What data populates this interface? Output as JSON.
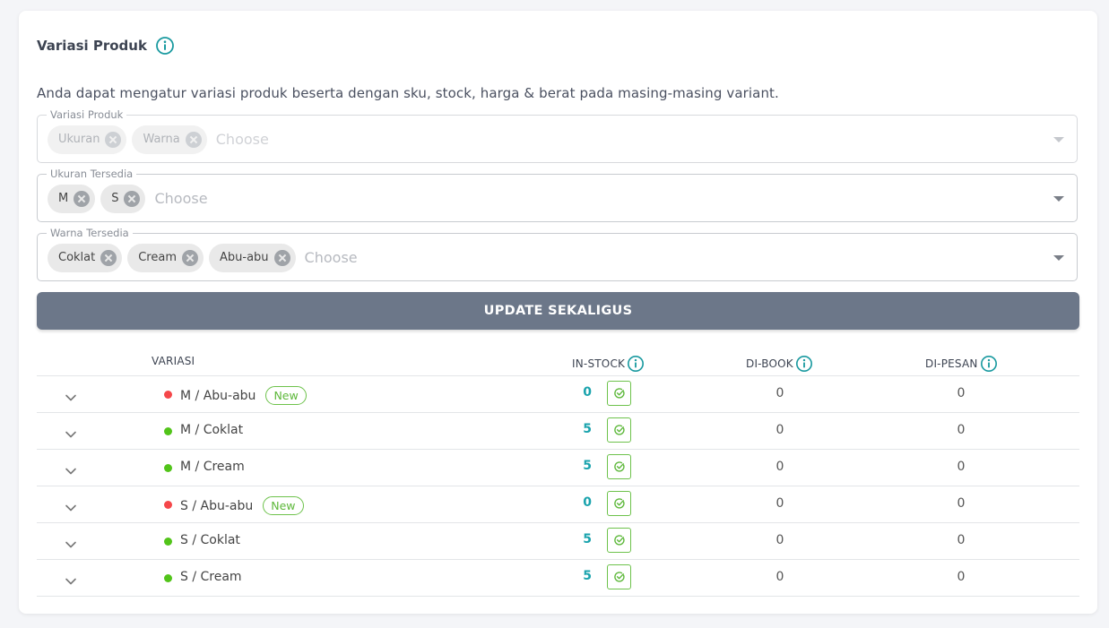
{
  "section": {
    "title": "Variasi Produk",
    "description": "Anda dapat mengatur variasi produk beserta dengan sku, stock, harga & berat pada masing-masing variant."
  },
  "fields": {
    "variasi_produk": {
      "label": "Variasi Produk",
      "chips": [
        "Ukuran",
        "Warna"
      ],
      "placeholder": "Choose"
    },
    "ukuran": {
      "label": "Ukuran Tersedia",
      "chips": [
        "M",
        "S"
      ],
      "placeholder": "Choose"
    },
    "warna": {
      "label": "Warna Tersedia",
      "chips": [
        "Coklat",
        "Cream",
        "Abu-abu"
      ],
      "placeholder": "Choose"
    }
  },
  "update_button": "UPDATE SEKALIGUS",
  "table": {
    "headers": {
      "variasi": "VARIASI",
      "in_stock": "IN-STOCK",
      "di_book": "DI-BOOK",
      "di_pesan": "DI-PESAN"
    },
    "rows": [
      {
        "name": "M / Abu-abu",
        "badge": "New",
        "status": "out",
        "stock": "0",
        "di_book": "0",
        "di_pesan": "0"
      },
      {
        "name": "M / Coklat",
        "badge": "",
        "status": "in",
        "stock": "5",
        "di_book": "0",
        "di_pesan": "0"
      },
      {
        "name": "M / Cream",
        "badge": "",
        "status": "in",
        "stock": "5",
        "di_book": "0",
        "di_pesan": "0"
      },
      {
        "name": "S / Abu-abu",
        "badge": "New",
        "status": "out",
        "stock": "0",
        "di_book": "0",
        "di_pesan": "0"
      },
      {
        "name": "S / Coklat",
        "badge": "",
        "status": "in",
        "stock": "5",
        "di_book": "0",
        "di_pesan": "0"
      },
      {
        "name": "S / Cream",
        "badge": "",
        "status": "in",
        "stock": "5",
        "di_book": "0",
        "di_pesan": "0"
      }
    ]
  },
  "colors": {
    "accent": "#1a9aa0",
    "in_stock_dot": "#52c41a",
    "out_stock_dot": "#f5474a",
    "badge_green": "#5db83a",
    "button": "#6c7789"
  },
  "icons": {
    "info": "info-circle-icon",
    "expand": "chevron-down-icon",
    "edit": "check-circle-icon",
    "remove_chip": "close-circle-icon"
  }
}
